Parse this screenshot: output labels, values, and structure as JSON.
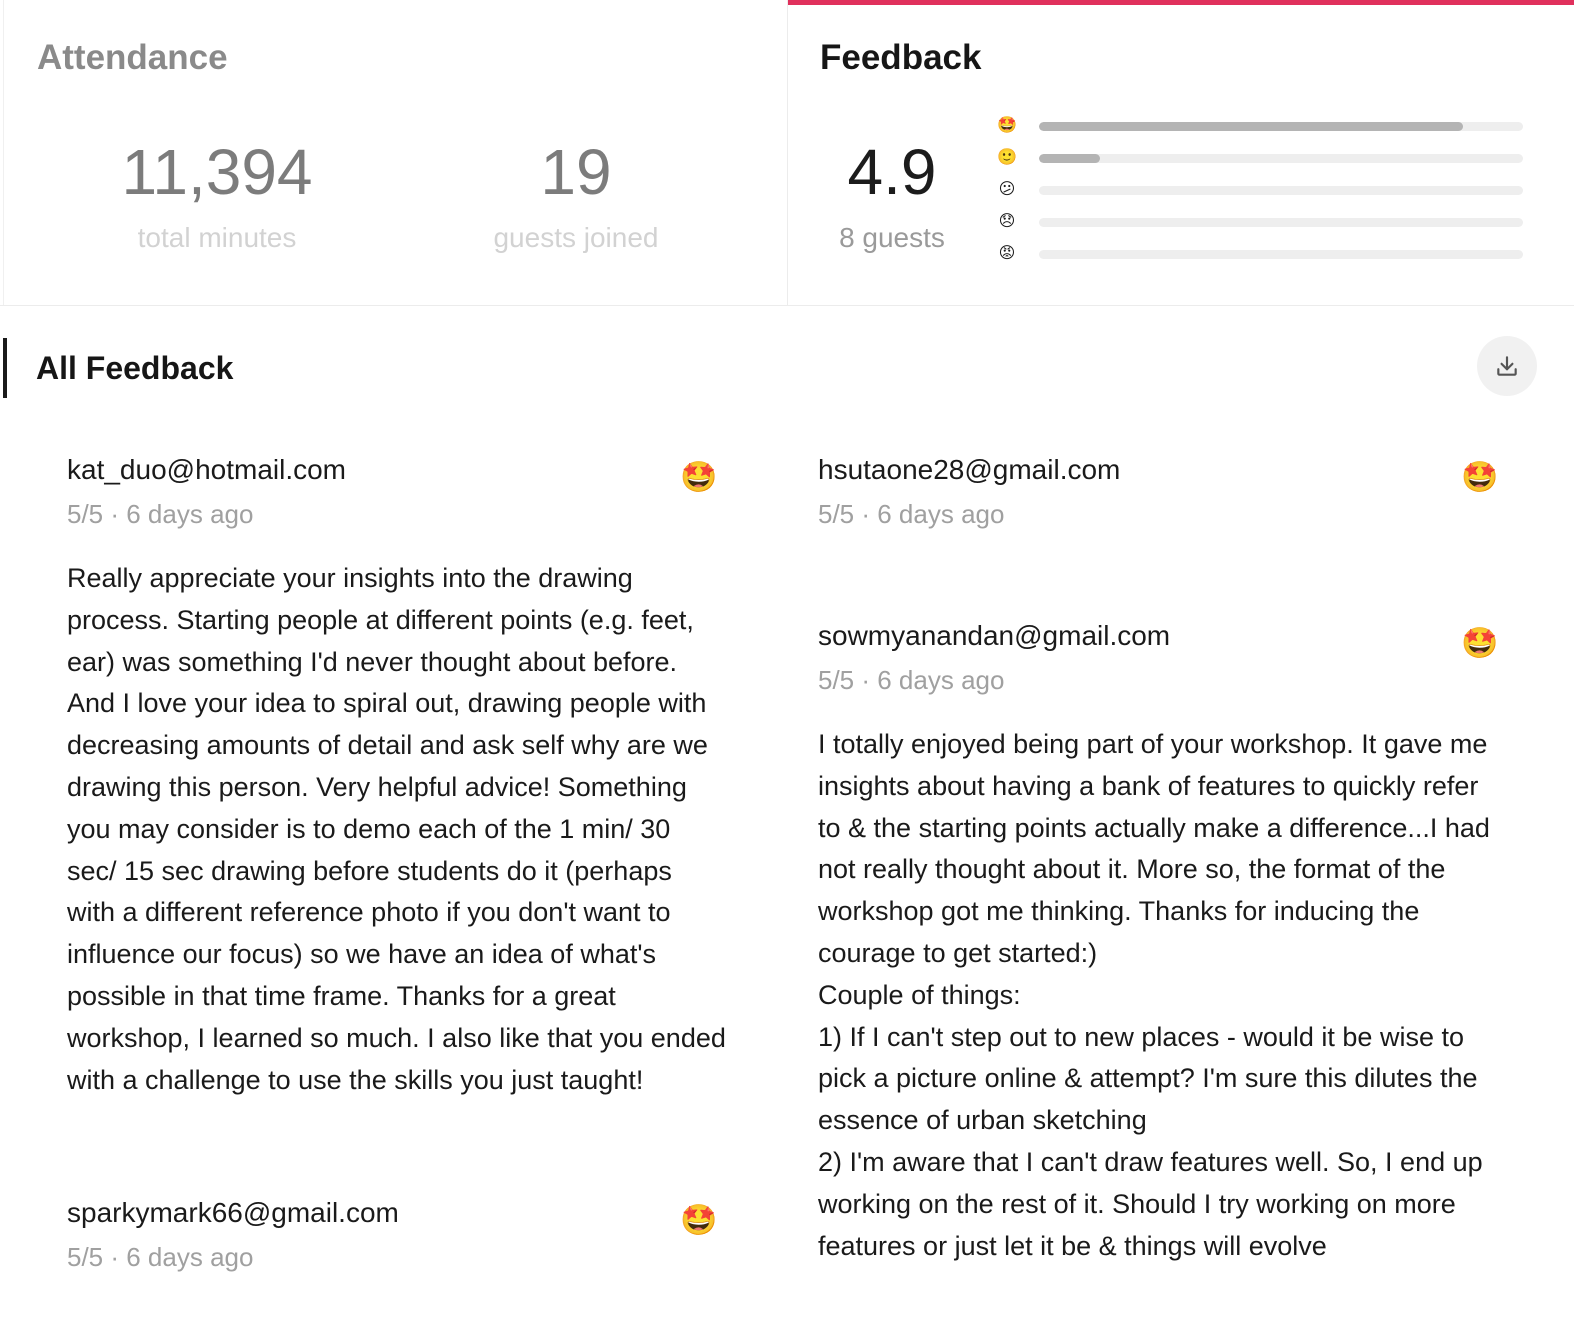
{
  "attendance": {
    "title": "Attendance",
    "total_minutes": "11,394",
    "total_minutes_label": "total minutes",
    "guests_joined": "19",
    "guests_joined_label": "guests joined"
  },
  "feedback": {
    "title": "Feedback",
    "accent_color": "#e0305c",
    "average_rating": "4.9",
    "guests_label": "8 guests",
    "distribution": [
      {
        "emoji": "star-struck-face-icon",
        "glyph": "🤩",
        "fraction": 0.875
      },
      {
        "emoji": "slightly-smiling-face-icon",
        "glyph": "🙂",
        "fraction": 0.125
      },
      {
        "emoji": "confused-face-icon",
        "glyph": "😕",
        "fraction": 0
      },
      {
        "emoji": "disappointed-face-icon",
        "glyph": "😞",
        "fraction": 0
      },
      {
        "emoji": "angry-face-icon",
        "glyph": "😡",
        "fraction": 0
      }
    ]
  },
  "all_feedback": {
    "title": "All Feedback",
    "download_icon": "download-icon",
    "left_column": [
      {
        "email": "kat_duo@hotmail.com",
        "meta": "5/5 · 6 days ago",
        "emoji": "star-struck-face-icon",
        "glyph": "🤩",
        "text": "Really appreciate your insights into the drawing process. Starting people at different points (e.g. feet, ear) was something I'd never thought about before. And I love your idea to spiral out, drawing people with decreasing amounts of detail and ask self why are we drawing this person. Very helpful advice! Something you may consider is to demo each of the 1 min/ 30 sec/ 15 sec drawing before students do it (perhaps with a different reference photo if you don't want to influence our focus) so we have an idea of what's possible in that time frame. Thanks for a great workshop, I learned so much. I also like that you ended with a challenge to use the skills you just taught!"
      },
      {
        "email": "sparkymark66@gmail.com",
        "meta": "5/5 · 6 days ago",
        "emoji": "star-struck-face-icon",
        "glyph": "🤩",
        "text": ""
      }
    ],
    "right_column": [
      {
        "email": "hsutaone28@gmail.com",
        "meta": "5/5 · 6 days ago",
        "emoji": "star-struck-face-icon",
        "glyph": "🤩",
        "text": ""
      },
      {
        "email": "sowmyanandan@gmail.com",
        "meta": "5/5 · 6 days ago",
        "emoji": "star-struck-face-icon",
        "glyph": "🤩",
        "text": "I totally enjoyed being part of your workshop. It gave me insights about having a bank of features to quickly refer to & the starting points actually make a difference...I had not really thought about it. More so, the format of the workshop got me thinking. Thanks for inducing the courage to get started:)\nCouple of things:\n1) If I can't step out to new places - would it be wise to pick a picture online & attempt? I'm sure this dilutes the essence of urban sketching\n2) I'm aware that I can't draw features well. So, I end up working on the rest of it. Should I try working on more features or just let it be & things will evolve"
      }
    ]
  }
}
